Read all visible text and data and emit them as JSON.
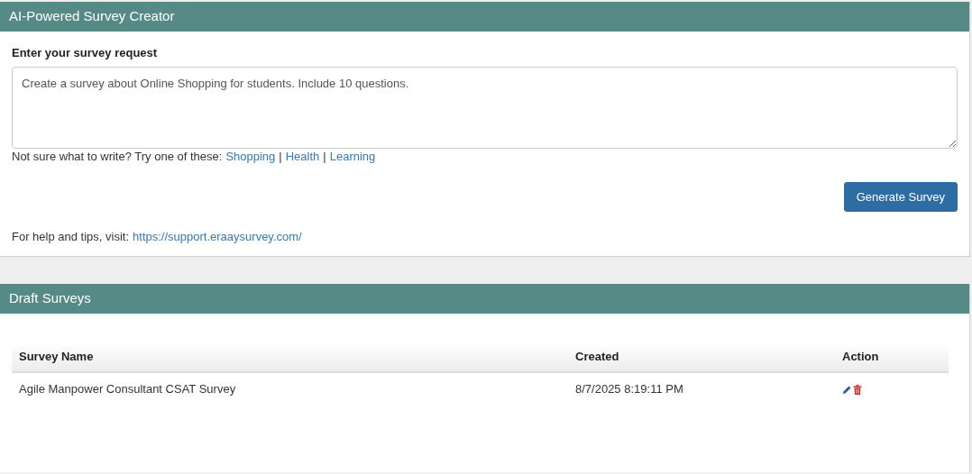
{
  "creator_panel": {
    "title": "AI-Powered Survey Creator",
    "field_label": "Enter your survey request",
    "request": {
      "value": "Create a survey about Online Shopping for students. Include 10 questions."
    },
    "suggestions_prompt": "Not sure what to write? Try one of these:",
    "suggestions": [
      "Shopping",
      "Health",
      "Learning"
    ],
    "separator": "|",
    "generate_button": "Generate Survey",
    "help_text": "For help and tips, visit:",
    "help_link": "https://support.eraaysurvey.com/"
  },
  "drafts_panel": {
    "title": "Draft Surveys",
    "table": {
      "columns": [
        "Survey Name",
        "Created",
        "Action"
      ],
      "rows": [
        {
          "survey_name": "Agile Manpower Consultant CSAT Survey",
          "created": "8/7/2025 8:19:11 PM"
        }
      ]
    }
  }
}
